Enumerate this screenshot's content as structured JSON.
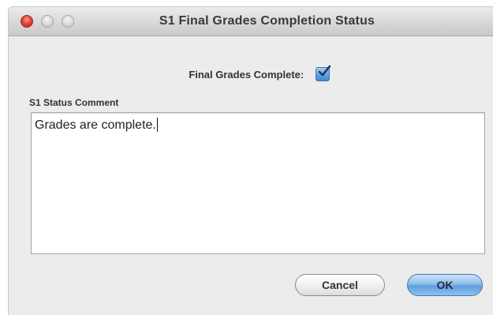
{
  "window": {
    "title": "S1 Final Grades Completion Status"
  },
  "form": {
    "complete_label": "Final Grades Complete:",
    "complete_checked": true,
    "comment_label": "S1 Status Comment",
    "comment_value": "Grades are complete."
  },
  "buttons": {
    "cancel_label": "Cancel",
    "ok_label": "OK"
  },
  "colors": {
    "close": "#e0463a",
    "checkbox": "#5d9ee0",
    "ok_button": "#8ebde9"
  }
}
